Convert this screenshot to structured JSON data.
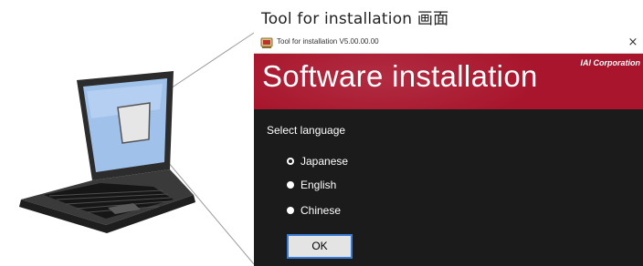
{
  "caption": "Tool for installation 画面",
  "window": {
    "title": "Tool for installation V5.00.00.00",
    "close_glyph": "×",
    "app_icon": "installer-app-icon"
  },
  "banner": {
    "title": "Software installation",
    "brand": "IAI Corporation",
    "color": "#a8152c"
  },
  "language": {
    "label": "Select language",
    "options": [
      {
        "label": "Japanese",
        "selected": true
      },
      {
        "label": "English",
        "selected": false
      },
      {
        "label": "Chinese",
        "selected": false
      }
    ]
  },
  "ok_button": {
    "label": "OK"
  },
  "colors": {
    "window_background": "#1b1b1b",
    "button_focus_border": "#3a7bd5"
  }
}
